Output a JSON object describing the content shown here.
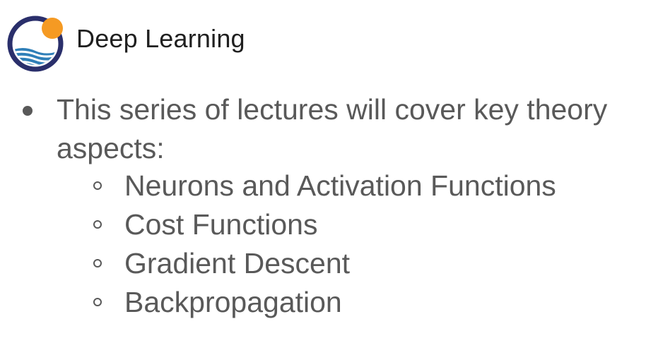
{
  "slide": {
    "title": "Deep Learning",
    "logo_icon": "wave-sun-logo-icon",
    "colors": {
      "logo_ring": "#2a2f6b",
      "logo_sun": "#f59a23",
      "logo_water": "#2f7fb8",
      "text": "#595959",
      "title": "#1f1f1f"
    },
    "main_point": "This series of lectures will cover key theory aspects:",
    "sub_points": [
      "Neurons and Activation Functions",
      "Cost Functions",
      "Gradient Descent",
      "Backpropagation"
    ]
  }
}
